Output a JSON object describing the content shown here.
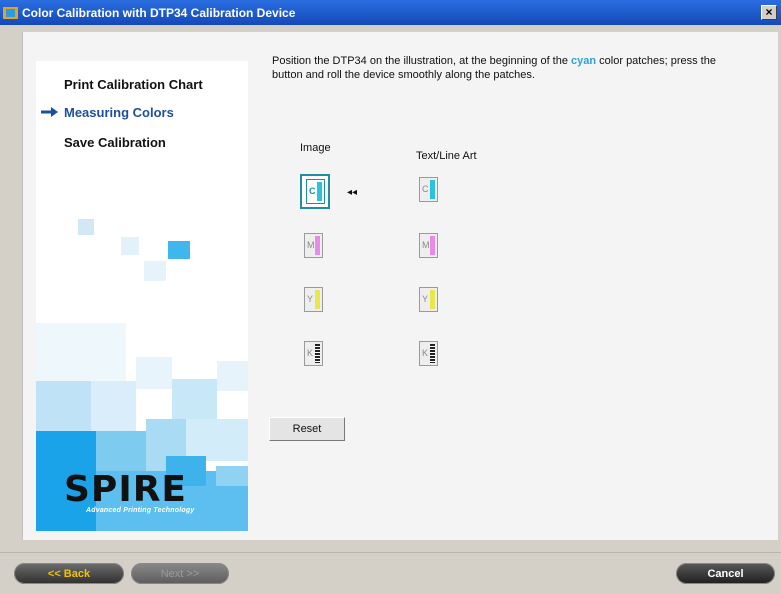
{
  "window": {
    "title": "Color Calibration with DTP34 Calibration Device",
    "close_label": "×"
  },
  "sidebar": {
    "steps": [
      {
        "label": "Print Calibration Chart",
        "active": false
      },
      {
        "label": "Measuring Colors",
        "active": true
      },
      {
        "label": "Save Calibration",
        "active": false
      }
    ],
    "logo": "SPIRE",
    "logo_tagline": "Advanced Printing Technology"
  },
  "main": {
    "instruction_before": "Position the DTP34 on the illustration, at the beginning of the ",
    "instruction_highlight": "cyan",
    "instruction_after": "  color patches; press the button and roll the device smoothly along the patches.",
    "columns": [
      {
        "label": "Image"
      },
      {
        "label": "Text/Line Art"
      }
    ],
    "patches": {
      "image": [
        {
          "letter": "C",
          "color": "#29c4dc",
          "selected": true
        },
        {
          "letter": "M",
          "color": "#e78be6",
          "selected": false
        },
        {
          "letter": "Y",
          "color": "#e8e84a",
          "selected": false
        },
        {
          "letter": "K",
          "color": "#222222",
          "selected": false
        }
      ],
      "text_line_art": [
        {
          "letter": "C",
          "color": "#29c4dc",
          "selected": false
        },
        {
          "letter": "M",
          "color": "#e78be6",
          "selected": false
        },
        {
          "letter": "Y",
          "color": "#e8e84a",
          "selected": false
        },
        {
          "letter": "K",
          "color": "#222222",
          "selected": false
        }
      ]
    },
    "current_indicator": "◂◂",
    "reset_label": "Reset"
  },
  "footer": {
    "back_label": "<< Back",
    "next_label": "Next >>",
    "cancel_label": "Cancel"
  },
  "colors": {
    "accent": "#1e4f9c",
    "highlight_cyan": "#29a3d6",
    "brand_blue": "#1aa3e8"
  }
}
